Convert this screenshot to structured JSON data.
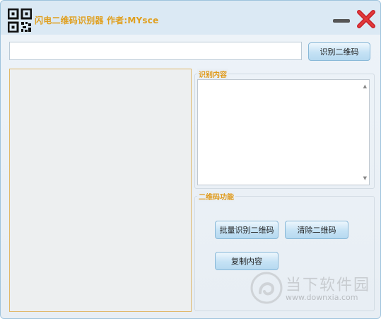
{
  "window": {
    "title": "闪电二维码识别器  作者:MYsce"
  },
  "toolbar": {
    "url_value": "",
    "recognize_label": "识别二维码"
  },
  "content_group": {
    "legend": "识别内容",
    "text_value": ""
  },
  "function_group": {
    "legend": "二维码功能",
    "batch_label": "批量识别二维码",
    "clear_label": "清除二维码",
    "copy_label": "复制内容"
  },
  "watermark": {
    "name": "当下软件园",
    "url": "www.downxia.com"
  },
  "colors": {
    "title": "#e0a020",
    "legend": "#e09a1a",
    "close": "#c8202a",
    "panel_border": "#e0b86a"
  },
  "icons": {
    "app": "qr-code-icon",
    "minimize": "minimize-icon",
    "close": "close-x-icon"
  }
}
